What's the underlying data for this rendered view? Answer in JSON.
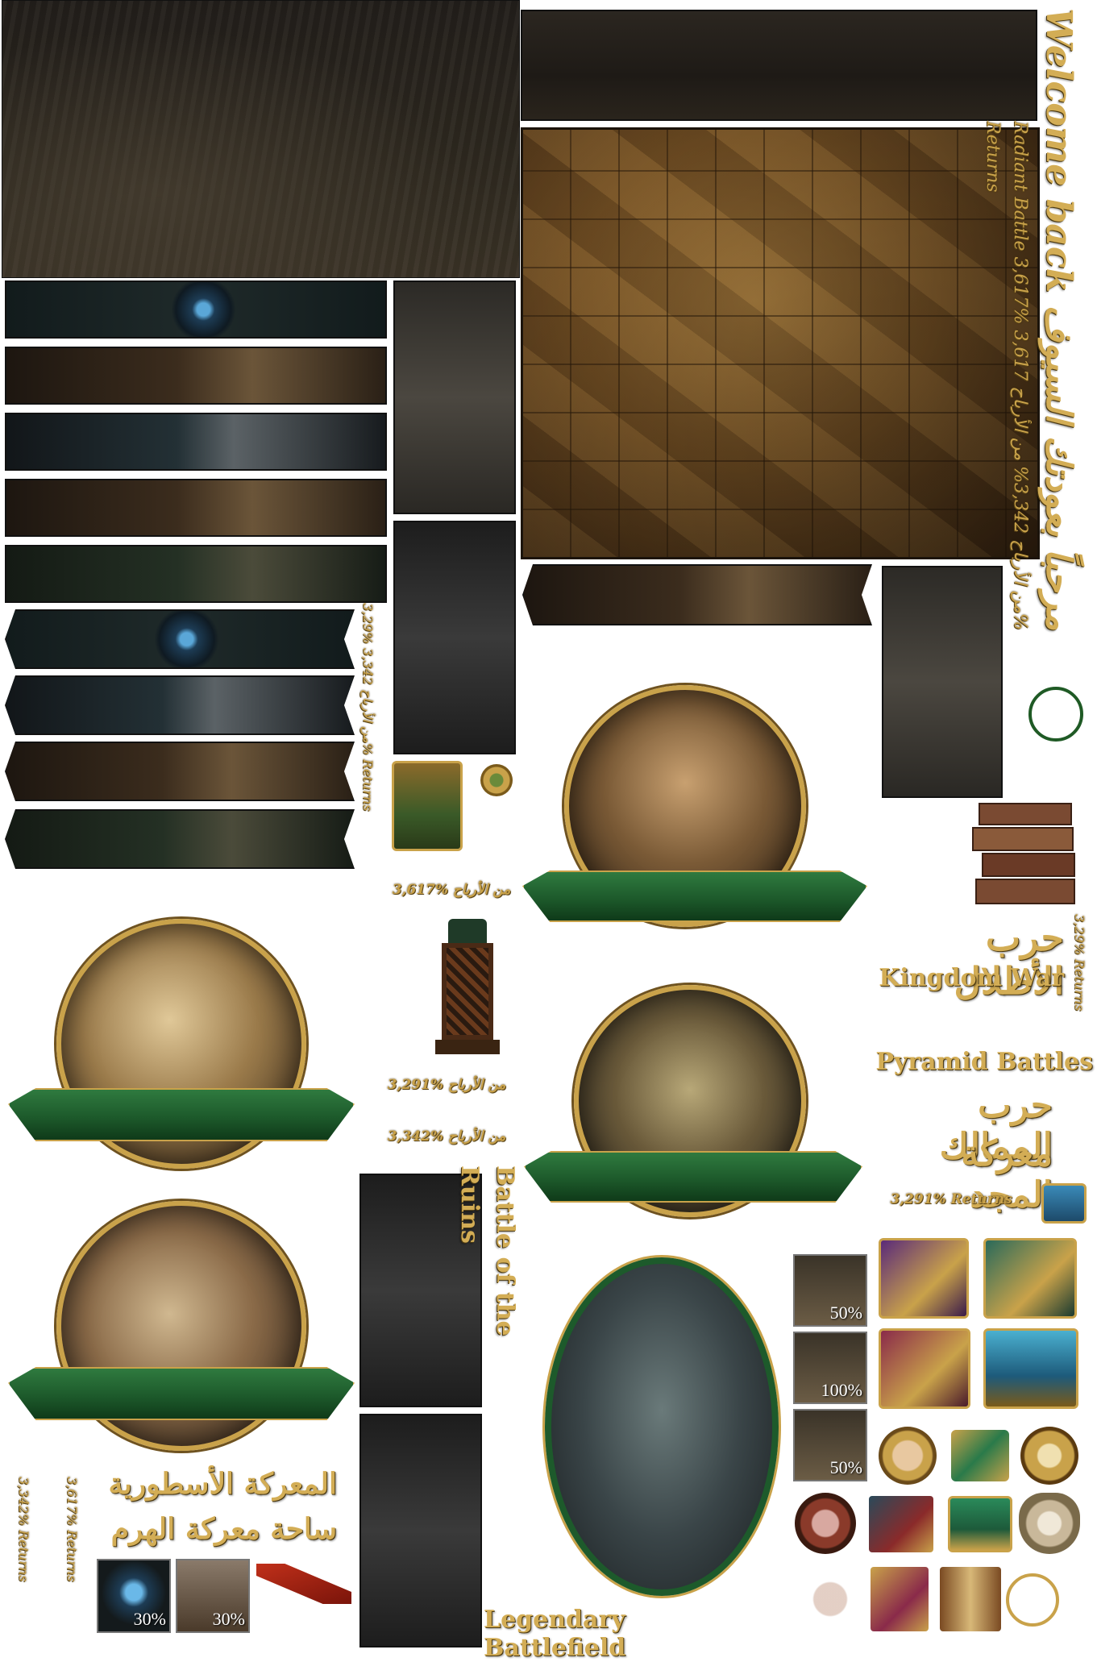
{
  "texts": {
    "welcome": "Welcome back مرحباً بعودتك السيوف",
    "radiant": "Radiant Battle 3,617% من الأرباح 3,342% من الأرباح 3,617% Returns",
    "returns_left": "3,29% من الأرباح 3,342% Returns",
    "profit_3617": "3,617% من الأرباح",
    "profit_3291": "3,291% من الأرباح",
    "profit_3342": "3,342% من الأرباح",
    "war_shadows_ar": "حرب الأطلال",
    "kingdom_war": "Kingdom War",
    "returns_329_vert": "3,29% Returns",
    "pyramid_battles": "Pyramid Battles",
    "kingdoms_war_ar": "حرب الممالك",
    "glory_battle_ar": "معركة المجد",
    "returns_3291": "3,291% Returns",
    "battle_of_ruins": "Battle of the Ruins",
    "legendary_battle_ar": "المعركة الأسطورية",
    "pyramid_arena_ar": "ساحة معركة الهرم",
    "returns_3342_vert": "3,342% Returns",
    "returns_3617_vert": "3,617% Returns",
    "legendary_battlefield": "Legendary Battlefield"
  },
  "thumbs": {
    "left_a": "30%",
    "left_b": "30%",
    "right_a": "50%",
    "right_b": "100%",
    "right_c": "50%"
  },
  "colors": {
    "gold": "#c9a24a",
    "ribbon_green": "#1d5a2b",
    "dark_panel": "#221e1a"
  }
}
